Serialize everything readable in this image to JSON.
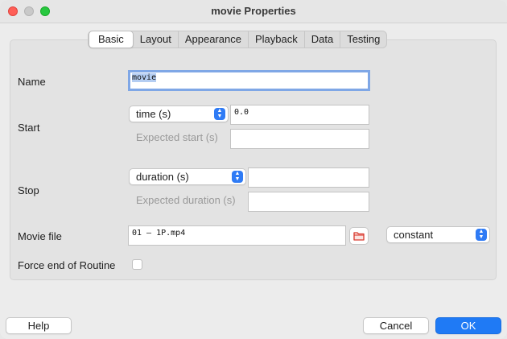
{
  "window": {
    "title": "movie Properties"
  },
  "tabs": [
    "Basic",
    "Layout",
    "Appearance",
    "Playback",
    "Data",
    "Testing"
  ],
  "active_tab": "Basic",
  "form": {
    "name": {
      "label": "Name",
      "value": "movie"
    },
    "start": {
      "label": "Start",
      "type_value": "time (s)",
      "value": "0.0",
      "expected_label": "Expected start (s)",
      "expected_value": ""
    },
    "stop": {
      "label": "Stop",
      "type_value": "duration (s)",
      "value": "",
      "expected_label": "Expected duration (s)",
      "expected_value": ""
    },
    "movie_file": {
      "label": "Movie file",
      "value": "01 – 1P.mp4",
      "update_value": "constant"
    },
    "force_end": {
      "label": "Force end of Routine",
      "checked": false
    }
  },
  "buttons": {
    "help": "Help",
    "cancel": "Cancel",
    "ok": "OK"
  },
  "colors": {
    "accent": "#1f7af5",
    "focus_ring": "#7fa7e6",
    "folder_icon": "#d93a2f"
  },
  "icons": {
    "browse": "folder-icon",
    "stepper": "up-down-chevrons-icon"
  }
}
